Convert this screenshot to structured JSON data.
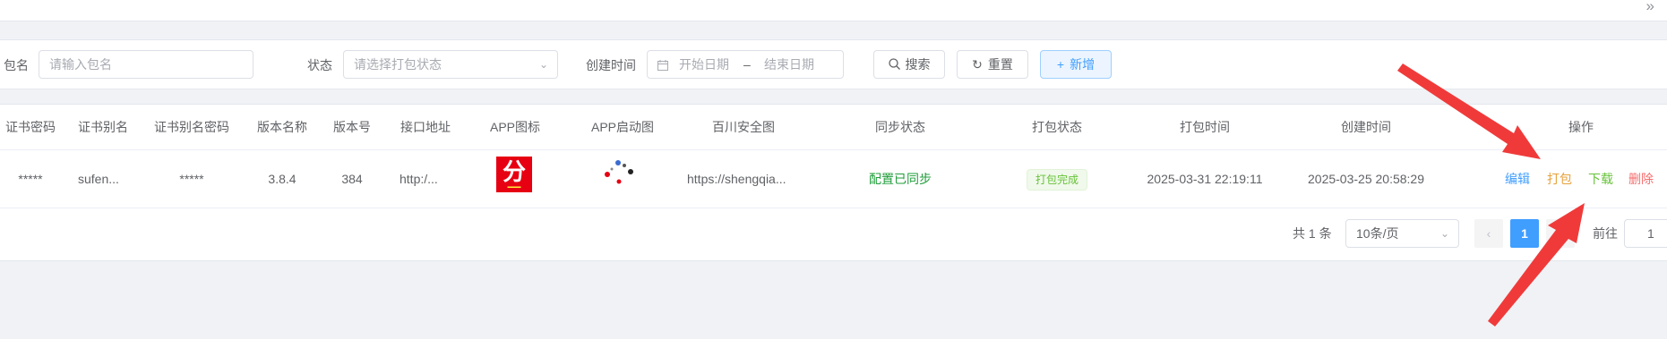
{
  "topbar": {
    "collapse_icon": "double-chevron-right"
  },
  "search": {
    "package_label": "包名",
    "package_placeholder": "请输入包名",
    "status_label": "状态",
    "status_placeholder": "请选择打包状态",
    "created_label": "创建时间",
    "start_placeholder": "开始日期",
    "range_sep": "–",
    "end_placeholder": "结束日期",
    "search_btn": "搜索",
    "reset_btn": "重置",
    "add_btn": "新增"
  },
  "table": {
    "columns": [
      "证书密码",
      "证书别名",
      "证书别名密码",
      "版本名称",
      "版本号",
      "接口地址",
      "APP图标",
      "APP启动图",
      "百川安全图",
      "同步状态",
      "打包状态",
      "打包时间",
      "创建时间",
      "操作"
    ],
    "rows": [
      {
        "cert_password": "*****",
        "cert_alias": "sufen...",
        "alias_password": "*****",
        "version_name": "3.8.4",
        "version_code": "384",
        "api_url": "http:/...",
        "app_icon_text": "分",
        "baichuan_image": "https://shengqia...",
        "sync_status": "配置已同步",
        "package_status": "打包完成",
        "package_time": "2025-03-31 22:19:11",
        "created_time": "2025-03-25 20:58:29",
        "actions": {
          "edit": "编辑",
          "package": "打包",
          "download": "下载",
          "delete": "删除"
        }
      }
    ]
  },
  "pagination": {
    "total": "共 1 条",
    "page_size": "10条/页",
    "prev": "‹",
    "current_page": "1",
    "goto_label": "前往",
    "goto_value": "1"
  },
  "colors": {
    "edit": "#409eff",
    "package": "#e6a23c",
    "download": "#67c23a",
    "delete": "#f56c6c",
    "sync_status": "#1f9d3a",
    "annotation_arrow": "#f03a3a"
  }
}
